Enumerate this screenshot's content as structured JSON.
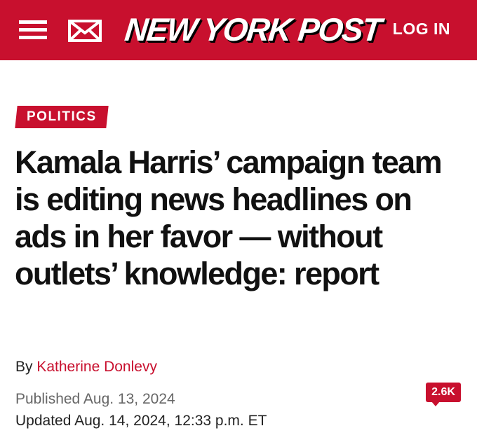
{
  "header": {
    "brand": "NEW YORK POST",
    "login_label": "LOG IN",
    "menu_icon": "hamburger-menu-icon",
    "mail_icon": "envelope-icon",
    "background_color": "#c8102e"
  },
  "article": {
    "section_tag": "POLITICS",
    "headline": "Kamala Harris’ campaign team is editing news headlines on ads in her favor — without outlets’ knowledge: report",
    "byline_prefix": "By",
    "author": "Katherine Donlevy",
    "published": "Published Aug. 13, 2024",
    "updated": "Updated Aug. 14, 2024, 12:33 p.m. ET",
    "comment_count": "2.6K",
    "accent_color": "#c8102e"
  }
}
